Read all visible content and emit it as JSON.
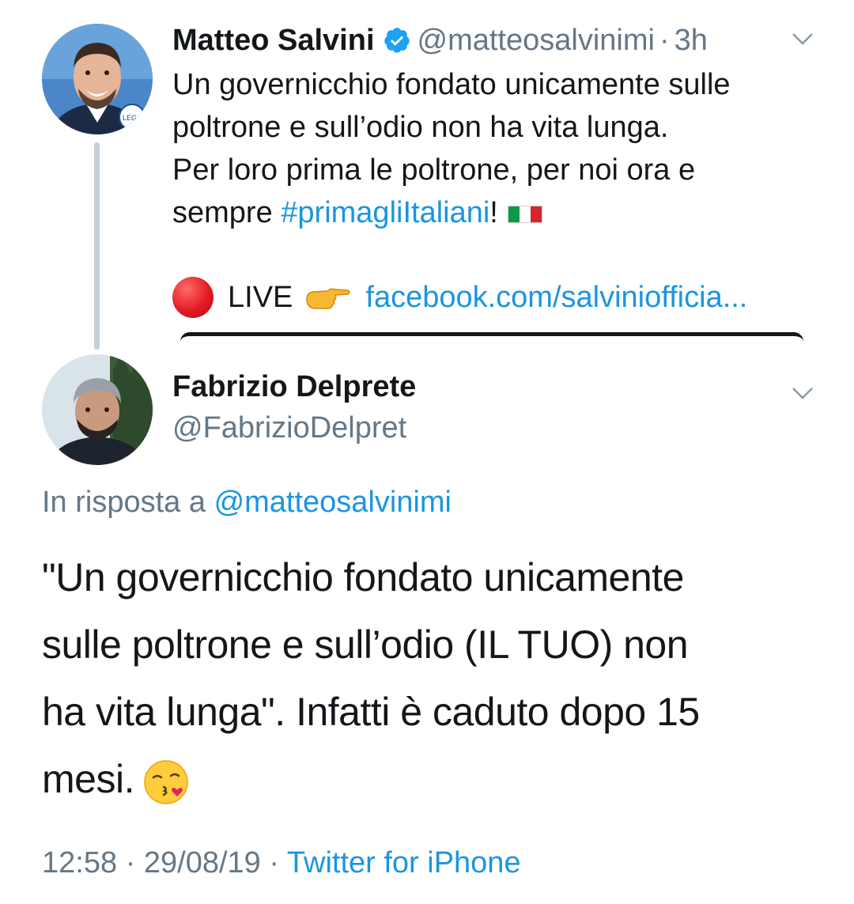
{
  "original_tweet": {
    "author_name": "Matteo Salvini",
    "author_handle": "@matteosalvinimi",
    "separator": "·",
    "time_ago": "3h",
    "text_line_1": "Un governicchio fondato unicamente sulle",
    "text_line_2": "poltrone e sull’odio non ha vita lunga.",
    "text_line_3": "Per loro prima le poltrone, per noi ora e",
    "text_line_4_prefix": "sempre ",
    "hashtag": "#primagliItaliani",
    "text_line_4_suffix": "!",
    "live_label": "LIVE",
    "link_text": "facebook.com/salviniofficia...",
    "avatar_badge_text": "LEGA",
    "icons": {
      "verified": "verified-badge-icon",
      "flag": "italy-flag-icon",
      "live": "red-circle-icon",
      "pointer": "pointing-hand-icon",
      "menu": "chevron-down-icon"
    }
  },
  "reply_tweet": {
    "author_name": "Fabrizio Delprete",
    "author_handle": "@FabrizioDelpret",
    "reply_to_label": "In risposta a",
    "reply_to_handle": "@matteosalvinimi",
    "text_line_1": "\"Un governicchio fondato unicamente",
    "text_line_2": "sulle poltrone e sull’odio (IL TUO) non",
    "text_line_3": "ha vita lunga\". Infatti è caduto dopo 15",
    "text_line_4": "mesi.",
    "emoji": "kissing-heart-face-icon",
    "time": "12:58",
    "dot": "·",
    "date": "29/08/19",
    "source": "Twitter for iPhone"
  },
  "colors": {
    "text": "#14171a",
    "secondary": "#657786",
    "link": "#1b95e0",
    "thread_line": "#c4cfd6"
  }
}
